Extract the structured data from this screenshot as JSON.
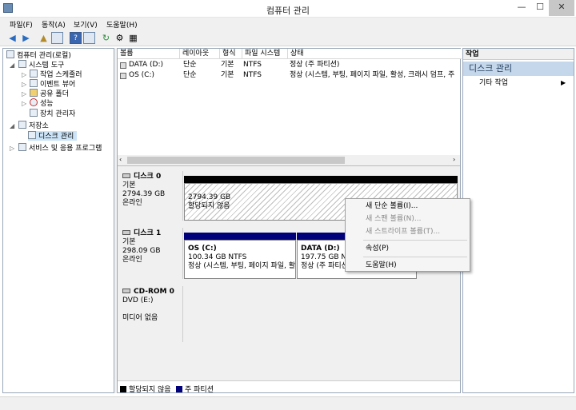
{
  "window": {
    "title": "컴퓨터 관리",
    "minimize": "—",
    "maximize": "☐",
    "close": "✕"
  },
  "menu": [
    "파일(F)",
    "동작(A)",
    "보기(V)",
    "도움말(H)"
  ],
  "tree": {
    "root": "컴퓨터 관리(로컬)",
    "system_tools": "시스템 도구",
    "task_scheduler": "작업 스케줄러",
    "event_viewer": "이벤트 뷰어",
    "shared_folders": "공유 폴더",
    "performance": "성능",
    "device_manager": "장치 관리자",
    "storage": "저장소",
    "disk_management": "디스크 관리",
    "services": "서비스 및 응용 프로그램"
  },
  "volumes": {
    "headers": [
      "볼륨",
      "레이아웃",
      "형식",
      "파일 시스템",
      "상태"
    ],
    "rows": [
      [
        "DATA (D:)",
        "단순",
        "기본",
        "NTFS",
        "정상 (주 파티션)"
      ],
      [
        "OS (C:)",
        "단순",
        "기본",
        "NTFS",
        "정상 (시스템, 부팅, 페이지 파일, 활성, 크래시 덤프, 주"
      ]
    ]
  },
  "disks": {
    "disk0": {
      "name": "디스크 0",
      "type": "기본",
      "size": "2794.39 GB",
      "status": "온라인",
      "part_size": "2794.39 GB",
      "part_status": "할당되지 않음"
    },
    "disk1": {
      "name": "디스크 1",
      "type": "기본",
      "size": "298.09 GB",
      "status": "온라인",
      "p1_name": "OS  (C:)",
      "p1_size": "100.34 GB NTFS",
      "p1_status": "정상 (시스템, 부팅, 페이지 파일, 활",
      "p2_name": "DATA  (D:)",
      "p2_size": "197.75 GB NTFS",
      "p2_status": "정상 (주 파티션)"
    },
    "cdrom": {
      "name": "CD-ROM 0",
      "type": "DVD (E:)",
      "status": "미디어 없음"
    }
  },
  "legend": {
    "unallocated": "할당되지 않음",
    "primary": "주 파티션"
  },
  "actions": {
    "header": "작업",
    "section": "디스크 관리",
    "item": "기타 작업"
  },
  "context_menu": {
    "new_simple": "새 단순 볼륨(I)...",
    "new_spanned": "새 스팬 볼륨(N)...",
    "new_striped": "새 스트라이프 볼륨(T)...",
    "properties": "속성(P)",
    "help": "도움말(H)"
  },
  "colors": {
    "unallocated": "#000000",
    "primary": "#00007b",
    "action_section": "#c5d7ea"
  }
}
